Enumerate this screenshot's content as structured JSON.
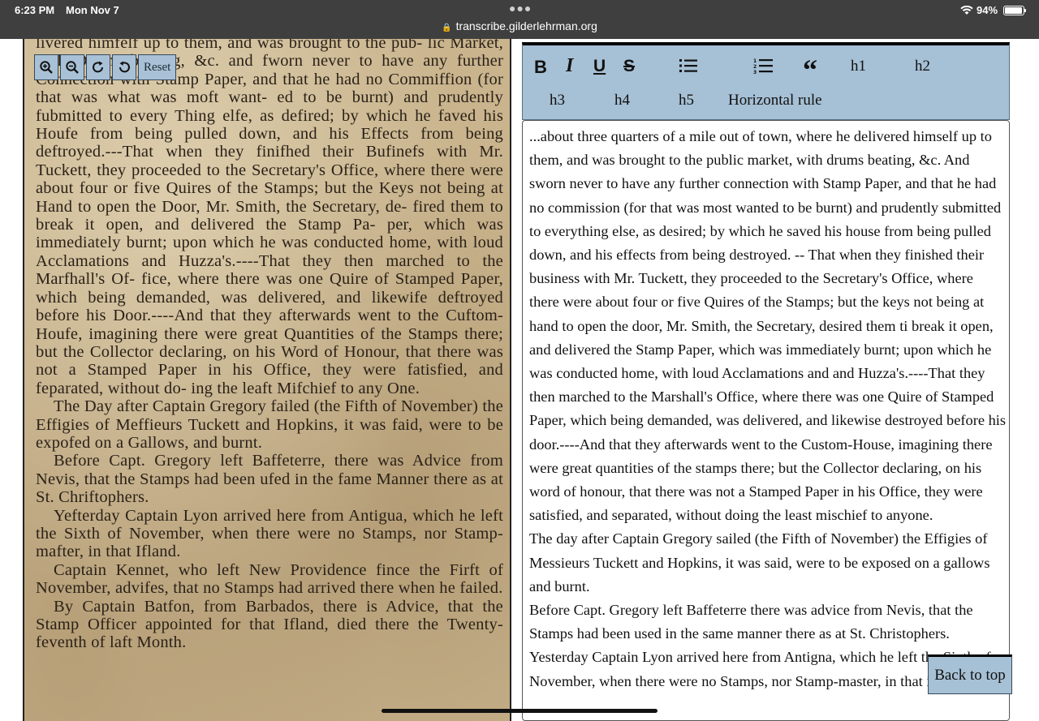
{
  "status_bar": {
    "time": "6:23 PM",
    "date": "Mon Nov 7",
    "url": "transcribe.gilderlehrman.org",
    "battery": "94%",
    "battery_level": 0.94
  },
  "scan_panel": {
    "zoom_in_icon": "zoom-in",
    "zoom_out_icon": "zoom-out",
    "rotate_right_icon": "rotate-clockwise",
    "rotate_left_icon": "rotate-counterclockwise",
    "reset_label": "Reset",
    "scan_lines": [
      "livered himfelf up to them, and was brought to the pub-",
      "lic Market, with Drums beating, &c. and fworn never to",
      "have any further Connection with Stamp Paper, and that",
      "he had no Commiffion (for that was what was moft want-",
      "ed to be burnt) and prudently fubmitted to every Thing",
      "elfe, as defired; by which he faved his Houfe from being",
      "pulled down, and his Effects from being deftroyed.---That",
      "when they finifhed their Bufinefs with Mr. Tuckett, they",
      "proceeded to the Secretary's Office, where there were about",
      "four or five Quires of the Stamps; but the Keys not being",
      "at Hand to open the Door, Mr. Smith, the Secretary, de-",
      "fired them to break it open, and delivered the Stamp Pa-",
      "per, which was immediately burnt; upon which he",
      "was conducted home, with loud Acclamations and",
      "Huzza's.----That they then marched to the Marfhall's Of-",
      "fice, where there was one Quire of Stamped Paper, which",
      "being demanded, was delivered, and likewife deftroyed",
      "before his Door.----And that they afterwards went to the",
      "Cuftom-Houfe, imagining there were great Quantities of",
      "the Stamps there; but the Collector declaring, on his",
      "Word of Honour, that there was not a Stamped Paper in",
      "his Office, they were fatisfied, and feparated, without do-",
      "ing the leaft Mifchief to any One."
    ],
    "scan_para2": "The Day after Captain Gregory failed (the Fifth of November) the Effigies of Meffieurs Tuckett and Hopkins, it was faid, were to be expofed on a Gallows, and burnt.",
    "scan_para3": "Before Capt. Gregory left Baffeterre, there was Advice from Nevis, that the Stamps had been ufed in the fame Manner there as at St. Chriftophers.",
    "scan_para4": "Yefterday Captain Lyon arrived here from Antigua, which he left the Sixth of November, when there were no Stamps, nor Stamp-mafter, in that Ifland.",
    "scan_para5": "Captain Kennet, who left New Providence fince the Firft of November, advifes, that no Stamps had arrived there when he failed.",
    "scan_para6": "By Captain Batfon, from Barbados, there is Advice, that the Stamp Officer appointed for that Ifland, died there the Twenty-feventh of laft Month."
  },
  "toolbar": {
    "bold": "B",
    "italic": "I",
    "underline": "U",
    "strike": "S",
    "bullet_list_icon": "bulleted-list",
    "numbered_list_icon": "numbered-list",
    "quote": "“",
    "h1": "h1",
    "h2": "h2",
    "h3": "h3",
    "h4": "h4",
    "h5": "h5",
    "hr": "Horizontal rule"
  },
  "editor": {
    "paragraphs": [
      "...about three quarters of a mile out of town, where he delivered himself up to them, and was brought to the public market, with drums beating, &c. And sworn never to have any further connection with Stamp Paper, and that he had no commission (for that was most wanted to be burnt) and prudently submitted to everything else, as desired; by which he saved his house from being pulled down, and his effects from being destroyed. -- That when they finished their business with Mr. Tuckett, they proceeded to the Secretary's Office, where there were about four or five Quires of the Stamps; but the keys not being at hand to open the door, Mr. Smith, the Secretary, desired them ti break it open, and delivered the Stamp Paper, which was immediately burnt; upon which he was conducted home, with loud Acclamations and and Huzza's.----That they then marched to the Marshall's Office, where there was one Quire of Stamped Paper, which being demanded, was delivered, and likewise destroyed before his door.----And that they afterwards went to the Custom-House, imagining there were great quantities of the stamps there; but the Collector declaring, on his word of honour, that there was not a Stamped Paper in his Office, they were satisfied, and separated, without doing the least mischief to anyone.",
      "The day after Captain Gregory sailed (the Fifth of November) the Effigies of Messieurs Tuckett and Hopkins, it was said, were to be exposed on a gallows and burnt.",
      "Before Capt. Gregory left Baffeterre there was advice from Nevis, that the Stamps had been used in the same manner there as at St. Christophers.",
      "Yesterday Captain Lyon arrived here from Antigna, which he left the Sixth of November, when there were no Stamps, nor Stamp-master, in that island."
    ]
  },
  "back_to_top": "Back to top"
}
